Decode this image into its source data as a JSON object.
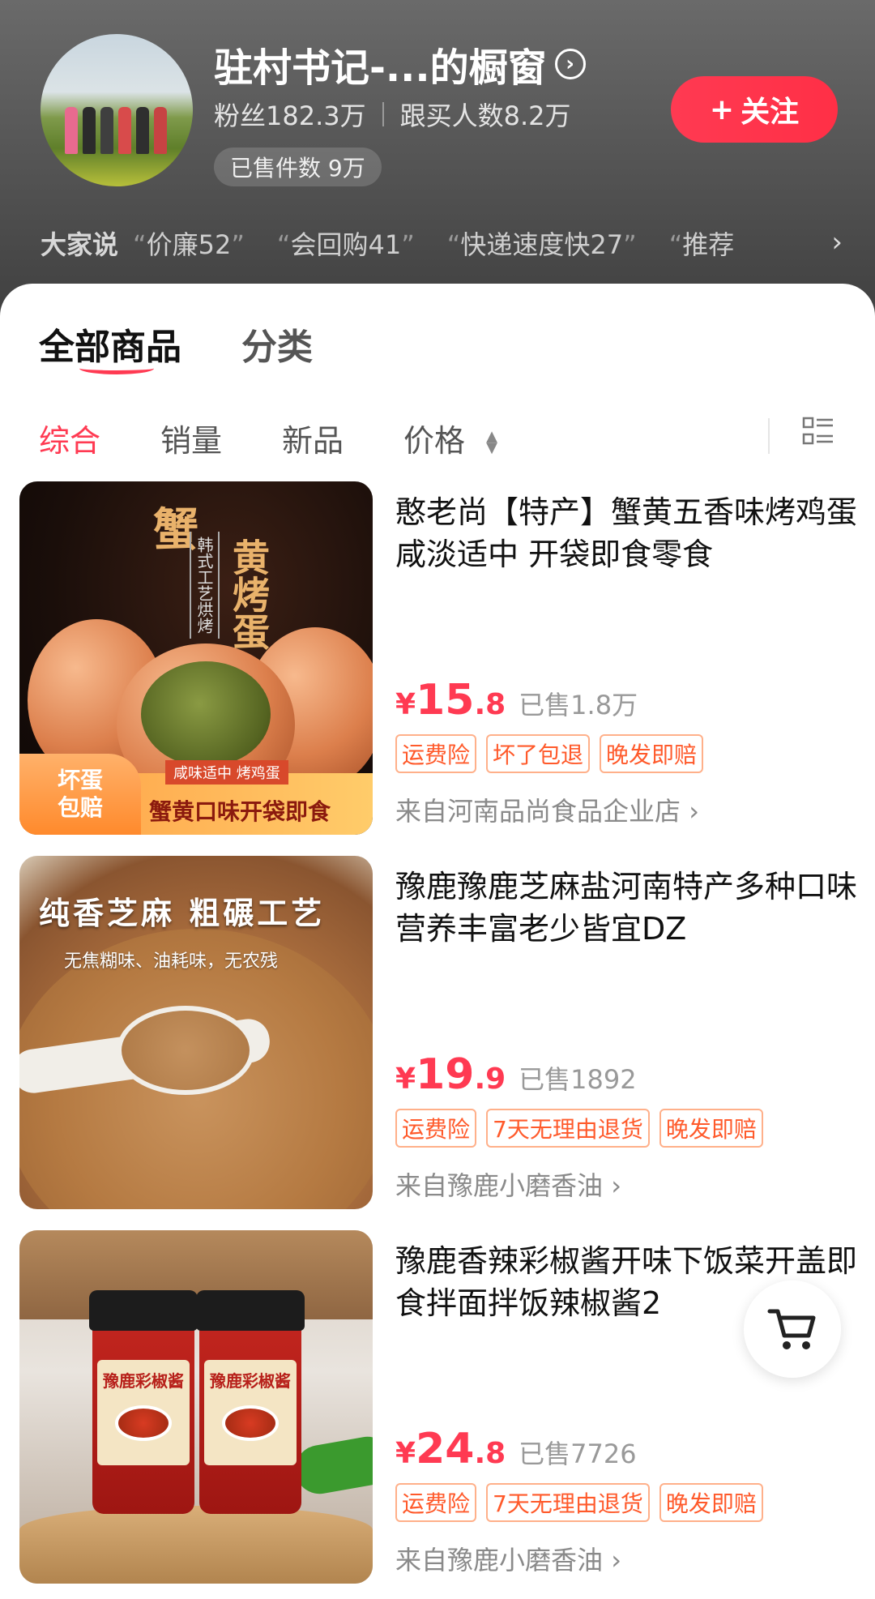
{
  "store": {
    "name": "驻村书记-...的橱窗",
    "fans": "粉丝182.3万",
    "followers_buy": "跟买人数8.2万",
    "sold_count": "已售件数 9万",
    "follow_label": "关注",
    "follow_plus": "+"
  },
  "reviews": {
    "label": "大家说",
    "tags": [
      "价廉52",
      "会回购41",
      "快递速度快27",
      "推荐"
    ]
  },
  "tabs": {
    "all": "全部商品",
    "category": "分类"
  },
  "sort": {
    "comprehensive": "综合",
    "sales": "销量",
    "new": "新品",
    "price": "价格"
  },
  "products": [
    {
      "title": "憨老尚【特产】蟹黄五香味烤鸡蛋 咸淡适中 开袋即食零食",
      "yen": "¥",
      "price_int": "15",
      "price_dec": ".8",
      "sold": "已售1.8万",
      "tags": [
        "运费险",
        "坏了包退",
        "晚发即赔"
      ],
      "shop": "来自河南品尚食品企业店",
      "image_text": {
        "h1": "蟹",
        "h2": "黄烤蛋",
        "vertical": "韩式工艺烘烤",
        "sub": "咸味适中 烤鸡蛋",
        "main": "蟹黄口味开袋即食",
        "badge_line1": "坏蛋",
        "badge_line2": "包赔"
      }
    },
    {
      "title": "豫鹿豫鹿芝麻盐河南特产多种口味营养丰富老少皆宜DZ",
      "yen": "¥",
      "price_int": "19",
      "price_dec": ".9",
      "sold": "已售1892",
      "tags": [
        "运费险",
        "7天无理由退货",
        "晚发即赔"
      ],
      "shop": "来自豫鹿小磨香油",
      "image_text": {
        "title": "纯香芝麻 粗碾工艺",
        "sub": "无焦糊味、油耗味，无农残"
      }
    },
    {
      "title": "豫鹿香辣彩椒酱开味下饭菜开盖即食拌面拌饭辣椒酱2",
      "yen": "¥",
      "price_int": "24",
      "price_dec": ".8",
      "sold": "已售7726",
      "tags": [
        "运费险",
        "7天无理由退货",
        "晚发即赔"
      ],
      "shop": "来自豫鹿小磨香油",
      "image_text": {
        "jar_label": "豫鹿彩椒酱"
      }
    }
  ],
  "icons": {
    "name_chevron": "chevron-circle-right-icon",
    "reviews_arrow": "chevron-right-icon",
    "sort_price": "sort-updown-icon",
    "view_toggle": "list-view-icon",
    "cart": "cart-icon"
  },
  "colors": {
    "accent": "#ff3a52",
    "tag_border": "#ffb08a",
    "tag_text": "#ff5a2b"
  }
}
